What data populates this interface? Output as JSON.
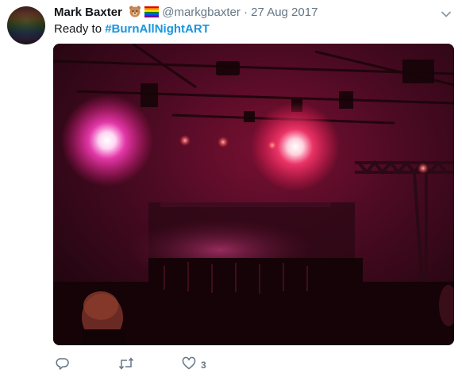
{
  "tweet": {
    "author_name": "Mark Baxter",
    "emoji": [
      "bear-face-emoji",
      "rainbow-flag-emoji"
    ],
    "handle": "@markgbaxter",
    "separator": "·",
    "date": "27 Aug 2017",
    "text_prefix": "Ready to ",
    "hashtag": "#BurnAllNightART",
    "image_description_icon": "stage-photo",
    "actions": {
      "reply_icon": "reply-icon",
      "retweet_icon": "retweet-icon",
      "like_icon": "heart-icon",
      "like_count": "3"
    }
  },
  "colors": {
    "hashtag": "#1b95e0",
    "muted": "#657786",
    "text": "#14171a"
  }
}
